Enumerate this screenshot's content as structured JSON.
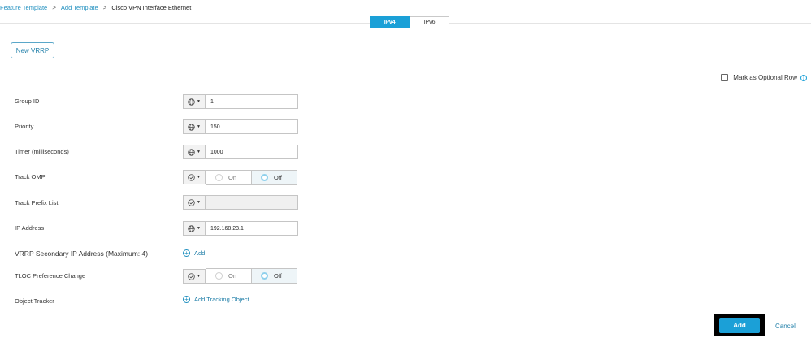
{
  "breadcrumb": {
    "items": [
      "Feature Template",
      "Add Template",
      "Cisco VPN Interface Ethernet"
    ],
    "separator": ">"
  },
  "tabs": [
    {
      "label": "IPv4",
      "active": true
    },
    {
      "label": "IPv6",
      "active": false
    }
  ],
  "new_vrrp_label": "New VRRP",
  "optional_row": {
    "label": "Mark as Optional Row",
    "checked": false,
    "info_icon": "i"
  },
  "fields": {
    "group_id": {
      "label": "Group ID",
      "value": "1",
      "scope_icon": "globe-icon"
    },
    "priority": {
      "label": "Priority",
      "value": "150",
      "scope_icon": "globe-icon"
    },
    "timer": {
      "label": "Timer (milliseconds)",
      "value": "1000",
      "scope_icon": "globe-icon"
    },
    "track_omp": {
      "label": "Track OMP",
      "scope_icon": "check-default-icon",
      "options": [
        "On",
        "Off"
      ],
      "selected": "Off"
    },
    "track_prefix_list": {
      "label": "Track Prefix List",
      "value": "",
      "scope_icon": "check-default-icon"
    },
    "ip_address": {
      "label": "IP Address",
      "value": "192.168.23.1",
      "scope_icon": "globe-icon"
    },
    "secondary_ip": {
      "label": "VRRP Secondary IP Address (Maximum: 4)",
      "add_label": "Add"
    },
    "tloc_pref": {
      "label": "TLOC Preference Change",
      "scope_icon": "check-default-icon",
      "options": [
        "On",
        "Off"
      ],
      "selected": "Off"
    },
    "object_tracker": {
      "label": "Object Tracker",
      "add_label": "Add Tracking Object"
    }
  },
  "footer": {
    "add_label": "Add",
    "cancel_label": "Cancel"
  },
  "colors": {
    "accent": "#1ba0d7",
    "link": "#1f7ea8"
  }
}
